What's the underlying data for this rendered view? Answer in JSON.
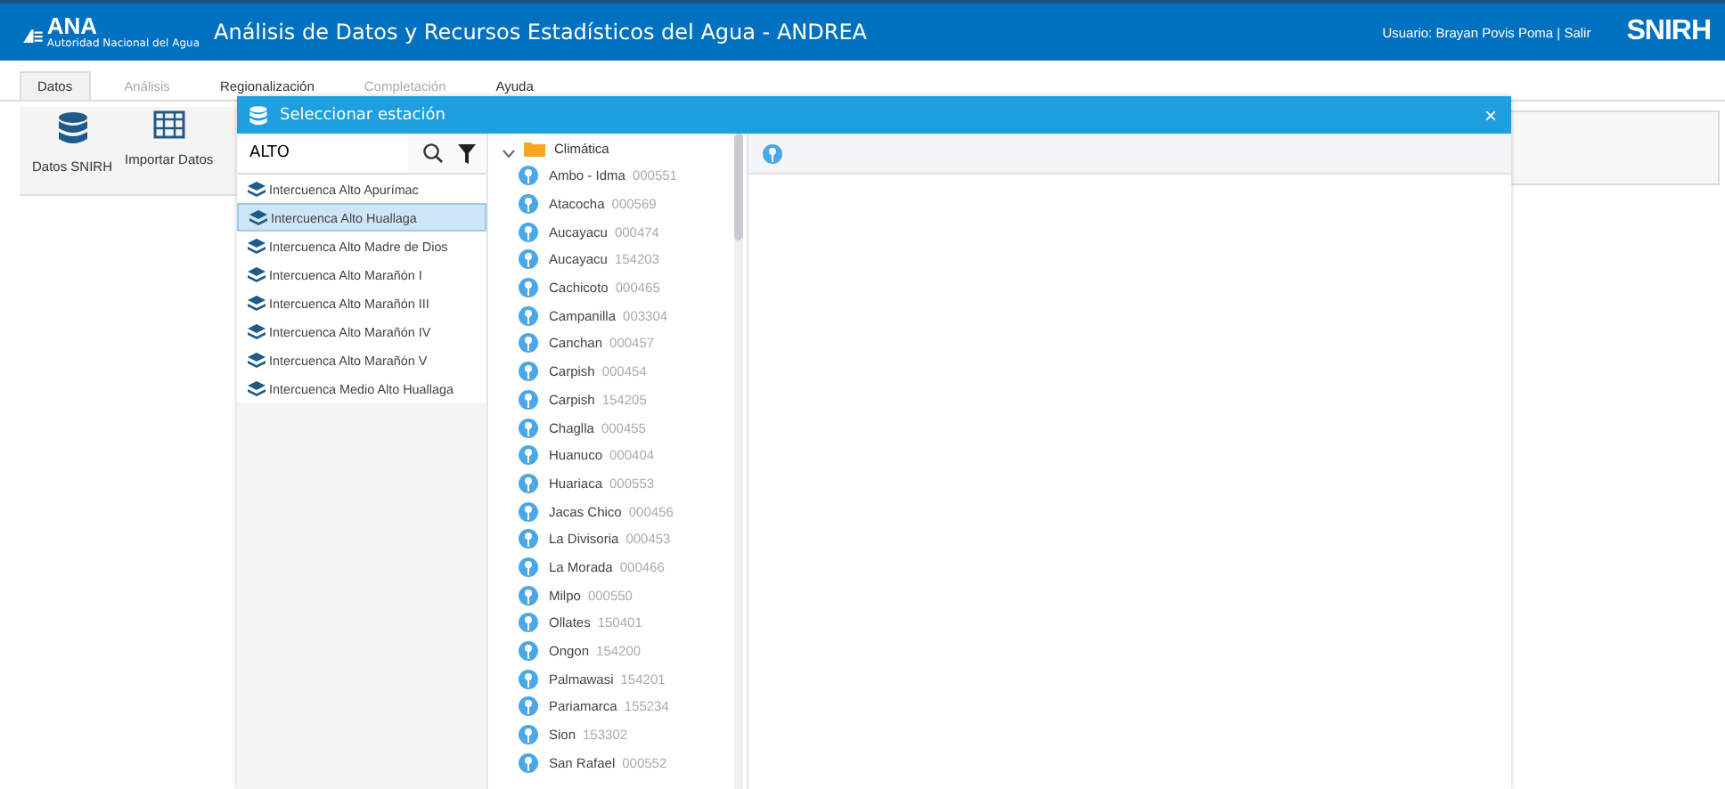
{
  "header": {
    "logo": "ANA",
    "logo_subtitle": "Autoridad Nacional del Agua",
    "title": "Análisis de Datos y Recursos Estadísticos del Agua - ANDREA",
    "user": "Usuario: Brayan Povis Poma | Salir",
    "brand": "SNIRH"
  },
  "menu_tabs": [
    {
      "label": "Datos",
      "selected": true,
      "disabled": false
    },
    {
      "label": "Análisis",
      "selected": false,
      "disabled": true
    },
    {
      "label": "Regionalización",
      "selected": false,
      "disabled": false
    },
    {
      "label": "Completación",
      "selected": false,
      "disabled": true
    },
    {
      "label": "Ayuda",
      "selected": false,
      "disabled": false
    }
  ],
  "toolbar": [
    {
      "label": "Datos SNIRH",
      "kind": "database"
    },
    {
      "label": "Importar Datos",
      "kind": "table"
    }
  ],
  "dialog": {
    "title": "Seleccionar estación",
    "close": "×",
    "search": {
      "value": "ALTO"
    },
    "basins": [
      {
        "label": "Intercuenca Alto Apurímac",
        "selected": false
      },
      {
        "label": "Intercuenca Alto Huallaga",
        "selected": true
      },
      {
        "label": "Intercuenca Alto Madre de Dios",
        "selected": false
      },
      {
        "label": "Intercuenca Alto Marañón I",
        "selected": false
      },
      {
        "label": "Intercuenca Alto Marañón III",
        "selected": false
      },
      {
        "label": "Intercuenca Alto Marañón IV",
        "selected": false
      },
      {
        "label": "Intercuenca Alto Marañón V",
        "selected": false
      },
      {
        "label": "Intercuenca Medio Alto Huallaga",
        "selected": false
      }
    ],
    "tree": [
      {
        "label": "Climática",
        "expanded": true,
        "children": [
          {
            "name": "Ambo - Idma",
            "code": "000551"
          },
          {
            "name": "Atacocha",
            "code": "000569"
          },
          {
            "name": "Aucayacu",
            "code": "000474"
          },
          {
            "name": "Aucayacu",
            "code": "154203"
          },
          {
            "name": "Cachicoto",
            "code": "000465"
          },
          {
            "name": "Campanilla",
            "code": "003304"
          },
          {
            "name": "Canchan",
            "code": "000457"
          },
          {
            "name": "Carpish",
            "code": "000454"
          },
          {
            "name": "Carpish",
            "code": "154205"
          },
          {
            "name": "Chaglla",
            "code": "000455"
          },
          {
            "name": "Huanuco",
            "code": "000404"
          },
          {
            "name": "Huariaca",
            "code": "000553"
          },
          {
            "name": "Jacas Chico",
            "code": "000456"
          },
          {
            "name": "La Divisoria",
            "code": "000453"
          },
          {
            "name": "La Morada",
            "code": "000466"
          },
          {
            "name": "Milpo",
            "code": "000550"
          },
          {
            "name": "Ollates",
            "code": "150401"
          },
          {
            "name": "Ongon",
            "code": "154200"
          },
          {
            "name": "Palmawasi",
            "code": "154201"
          },
          {
            "name": "Pariamarca",
            "code": "155234"
          },
          {
            "name": "Sion",
            "code": "153302"
          },
          {
            "name": "San Rafael",
            "code": "000552"
          }
        ]
      }
    ]
  }
}
